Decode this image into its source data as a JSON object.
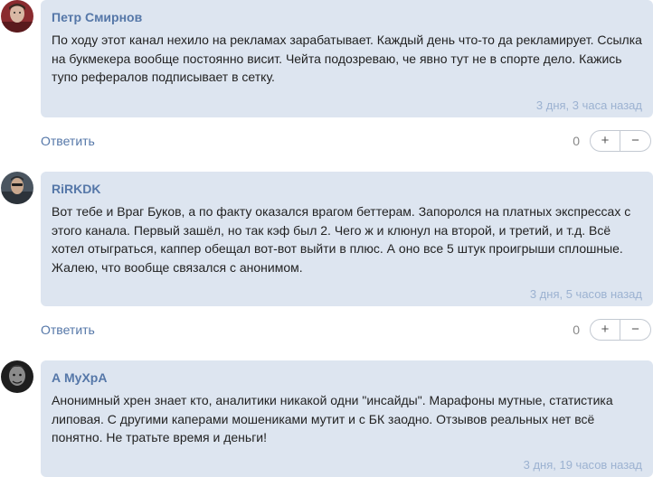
{
  "comments": [
    {
      "author": "Петр Смирнов",
      "text": "По ходу этот канал нехило на рекламах зарабатывает. Каждый день что-то да рекламирует. Ссылка на букмекера вообще постоянно висит. Чейта подозреваю, че явно тут не в спорте дело. Кажись тупо рефералов подписывает в сетку.",
      "time": "3 дня, 3 часа назад",
      "reply_label": "Ответить",
      "score": "0",
      "plus_label": "+",
      "minus_label": "−"
    },
    {
      "author": "RiRKDK",
      "text": "Вот тебе и Враг Буков, а по факту оказался врагом беттерам. Запоролся на платных экспрессах с этого канала. Первый зашёл, но так кэф был 2. Чего ж и клюнул на второй, и третий, и т.д. Всё хотел отыграться, каппер обещал вот-вот выйти в плюс. А оно все 5 штук проигрыши сплошные. Жалею, что вообще связался с анонимом.",
      "time": "3 дня, 5 часов назад",
      "reply_label": "Ответить",
      "score": "0",
      "plus_label": "+",
      "minus_label": "−"
    },
    {
      "author": "А МуХрА",
      "text": "Анонимный хрен знает кто, аналитики никакой одни \"инсайды\". Марафоны мутные, статистика липовая. С другими каперами мошениками мутит и с БК заодно. Отзывов реальных нет всё понятно. Не тратьте время и деньги!",
      "time": "3 дня, 19 часов назад"
    }
  ]
}
